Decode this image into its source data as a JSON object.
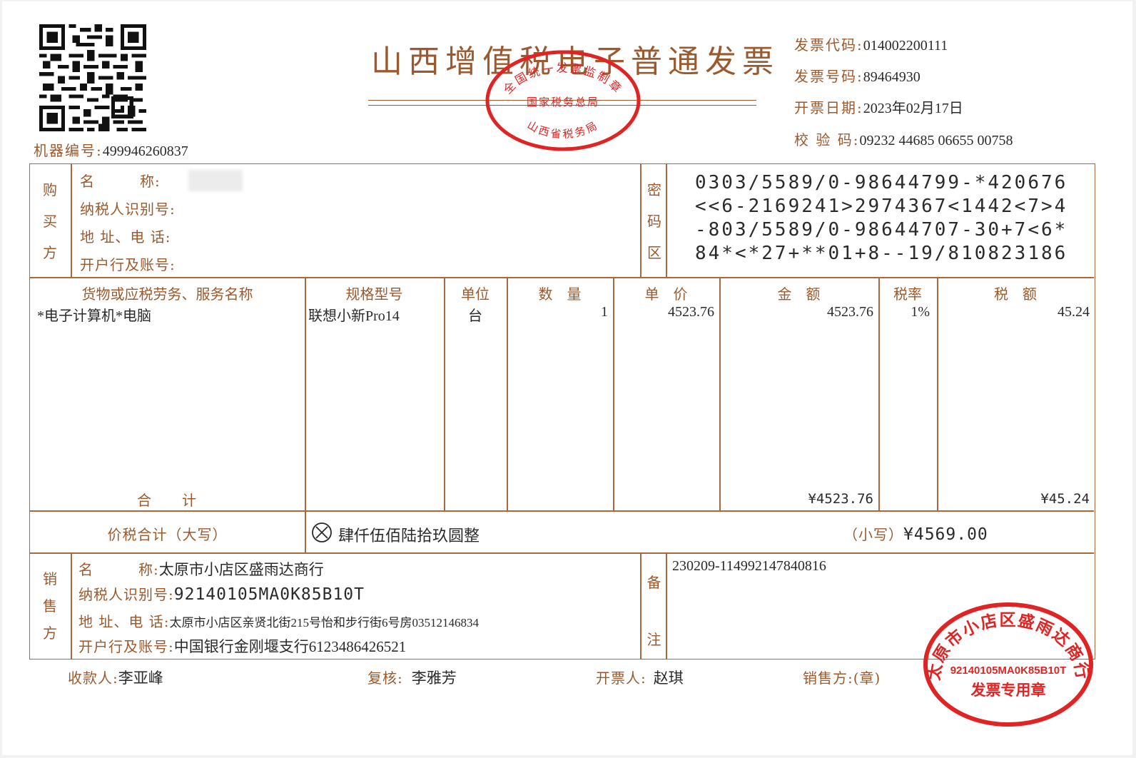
{
  "title": "山西增值税电子普通发票",
  "machine_no": {
    "label": "机器编号:",
    "value": "499946260837"
  },
  "header": {
    "code": {
      "label": "发票代码:",
      "value": "014002200111"
    },
    "number": {
      "label": "发票号码:",
      "value": "89464930"
    },
    "date": {
      "label": "开票日期:",
      "value": "2023年02月17日"
    },
    "check": {
      "label": "校 验 码:",
      "value": "09232 44685 06655 00758"
    }
  },
  "buyer": {
    "section_label": [
      "购",
      "买",
      "方"
    ],
    "name_label": "名　　　称:",
    "name_value": "",
    "tax_id_label": "纳税人识别号:",
    "address_label": "地 址、电 话:",
    "bank_label": "开户行及账号:"
  },
  "cipher": {
    "section_label": [
      "密",
      "码",
      "区"
    ],
    "lines": [
      "0303/5589/0-98644799-*420676",
      "<<6-2169241>2974367<1442<7>4",
      "-803/5589/0-98644707-30+7<6*",
      "84*<*27+**01+8--19/810823186"
    ]
  },
  "items": {
    "headers": {
      "name": "货物或应税劳务、服务名称",
      "spec": "规格型号",
      "unit": "单位",
      "qty": "数　量",
      "price": "单　价",
      "amount": "金　额",
      "rate": "税率",
      "tax": "税　额"
    },
    "rows": [
      {
        "name": "*电子计算机*电脑",
        "spec": "联想小新Pro14",
        "unit": "台",
        "qty": "1",
        "price": "4523.76",
        "amount": "4523.76",
        "rate": "1%",
        "tax": "45.24"
      }
    ],
    "total_label": "合　　计",
    "total_amount": "¥4523.76",
    "total_tax": "¥45.24"
  },
  "grand_total": {
    "label": "价税合计（大写）",
    "words": "肆仟伍佰陆拾玖圆整",
    "small_label": "（小写）",
    "small_value": "¥4569.00"
  },
  "seller": {
    "section_label": [
      "销",
      "售",
      "方"
    ],
    "name_label": "名　　　称:",
    "name_value": "太原市小店区盛雨达商行",
    "tax_id_label": "纳税人识别号:",
    "tax_id_value": "92140105MA0K85B10T",
    "address_label": "地 址、电 话:",
    "address_value": "太原市小店区亲贤北街215号怡和步行街6号房03512146834",
    "bank_label": "开户行及账号:",
    "bank_value": "中国银行金刚堰支行6123486426521"
  },
  "remarks": {
    "section_label": [
      "备",
      "注"
    ],
    "value": "230209-114992147840816"
  },
  "footer": {
    "payee_label": "收款人:",
    "payee": "李亚峰",
    "reviewer_label": "复核:",
    "reviewer": "李雅芳",
    "issuer_label": "开票人:",
    "issuer": "赵琪",
    "seller_label": "销售方:(章)"
  },
  "seal_tax": {
    "top": "全国统一发票监制章",
    "middle": "国家税务总局",
    "bottom": "山西省税务局"
  },
  "seal_seller": {
    "top": "太原市小店区盛雨达商行",
    "middle": "92140105MA0K85B10T",
    "bottom": "发票专用章"
  },
  "colors": {
    "ink": "#9b5a2e",
    "seal": "#e02424",
    "text": "#2a2a2a"
  }
}
